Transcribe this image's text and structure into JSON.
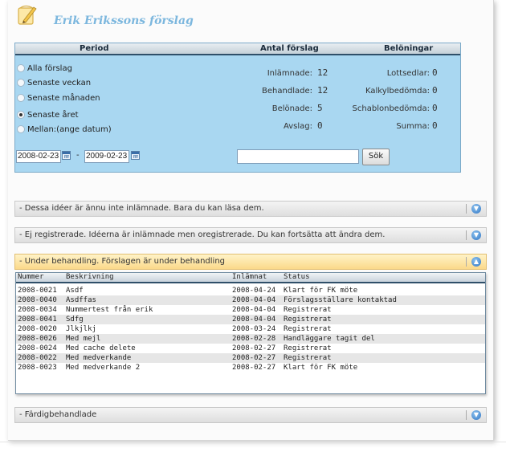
{
  "page": {
    "title": "Erik Erikssons förslag"
  },
  "filter": {
    "headers": {
      "period": "Period",
      "antal": "Antal förslag",
      "beloningar": "Belöningar"
    },
    "period_options": [
      {
        "label": "Alla förslag",
        "checked": false
      },
      {
        "label": "Senaste veckan",
        "checked": false
      },
      {
        "label": "Senaste månaden",
        "checked": false
      },
      {
        "label": "Senaste året",
        "checked": true
      },
      {
        "label": "Mellan:(ange datum)",
        "checked": false
      }
    ],
    "counts": [
      {
        "label": "Inlämnade:",
        "value": "12"
      },
      {
        "label": "Behandlade:",
        "value": "12"
      },
      {
        "label": "Belönade:",
        "value": "5"
      },
      {
        "label": "Avslag:",
        "value": "0"
      }
    ],
    "rewards": [
      {
        "label": "Lottsedlar:",
        "value": "0"
      },
      {
        "label": "Kalkylbedömda:",
        "value": "0"
      },
      {
        "label": "Schablonbedömda:",
        "value": "0"
      },
      {
        "label": "Summa:",
        "value": "0"
      }
    ],
    "date_from": "2008-02-23",
    "date_sep": "-",
    "date_to": "2009-02-23",
    "search_value": "",
    "search_button": "Sök"
  },
  "sections": {
    "not_submitted": "- Dessa idéer är ännu inte inlämnade. Bara du kan läsa dem.",
    "unregistered": "- Ej registrerade. Idéerna är inlämnade men oregistrerade. Du kan fortsätta att ändra dem.",
    "under_review": "- Under behandling. Förslagen är under behandling",
    "completed": "- Färdigbehandlade"
  },
  "table": {
    "columns": [
      "Nummer",
      "Beskrivning",
      "Inlämnat",
      "Status"
    ],
    "rows": [
      [
        "2008-0021",
        "Asdf",
        "2008-04-24",
        "Klart för FK möte"
      ],
      [
        "2008-0040",
        "Asdffas",
        "2008-04-04",
        "Förslagsställare kontaktad"
      ],
      [
        "2008-0034",
        "Nummertest från erik",
        "2008-04-04",
        "Registrerat"
      ],
      [
        "2008-0041",
        "Sdfg",
        "2008-04-04",
        "Registrerat"
      ],
      [
        "2008-0020",
        "Jlkjlkj",
        "2008-03-24",
        "Registrerat"
      ],
      [
        "2008-0026",
        "Med mejl",
        "2008-02-28",
        "Handläggare tagit del"
      ],
      [
        "2008-0024",
        "Med cache delete",
        "2008-02-27",
        "Registrerat"
      ],
      [
        "2008-0022",
        "Med medverkande",
        "2008-02-27",
        "Registrerat"
      ],
      [
        "2008-0023",
        "Med medverkande 2",
        "2008-02-27",
        "Klart för FK möte"
      ]
    ]
  },
  "colors": {
    "title": "#7cb7de",
    "filter_bg": "#a9d7f1",
    "active_section": "#fbd98a"
  }
}
